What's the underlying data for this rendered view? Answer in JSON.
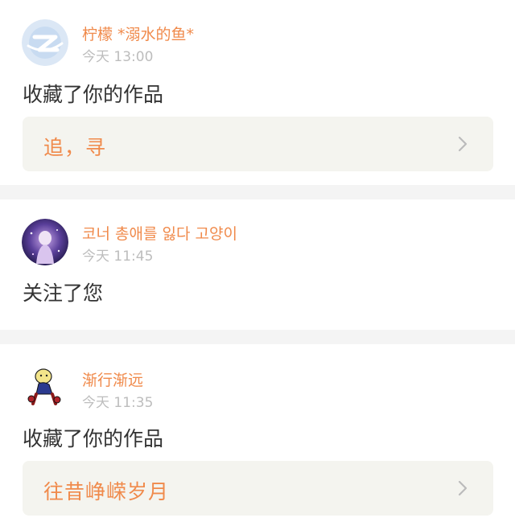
{
  "notifications": [
    {
      "user": "柠檬 *溺水的鱼*",
      "time": "今天 13:00",
      "action": "收藏了你的作品",
      "work": "追，寻",
      "avatar_icon": "qzone-logo-icon"
    },
    {
      "user": "코너 총애를 잃다 고양이",
      "time": "今天 11:45",
      "action": "关注了您",
      "avatar_icon": "anime-girl-avatar"
    },
    {
      "user": "渐行渐远",
      "time": "今天 11:35",
      "action": "收藏了你的作品",
      "work": "往昔峥嵘岁月",
      "avatar_icon": "cartoon-character-avatar"
    }
  ],
  "colors": {
    "accent": "#f08a4b",
    "time_text": "#bdbdbd",
    "body_text": "#333333",
    "work_box_bg": "#f4f4ef",
    "page_bg": "#f4f4f4"
  }
}
